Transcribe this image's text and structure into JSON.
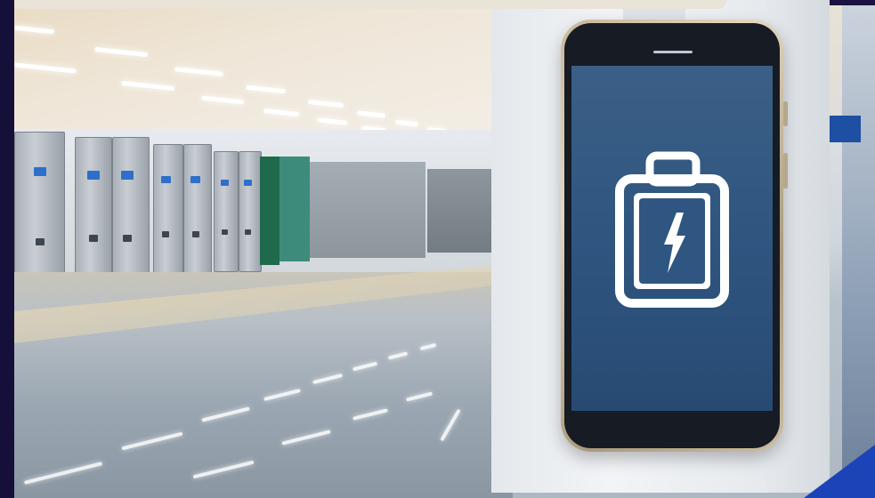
{
  "scene": {
    "description_tag": "",
    "accent_color": "#2f5680",
    "brand_blue": "#1c44b8"
  },
  "phone": {
    "screen_icon": "battery-charging-icon",
    "screen_color": "#2f5680",
    "icon_color": "#ffffff"
  },
  "background": {
    "elements": [
      "ceiling-lights",
      "lockers",
      "reflective-floor",
      "pillar"
    ]
  }
}
